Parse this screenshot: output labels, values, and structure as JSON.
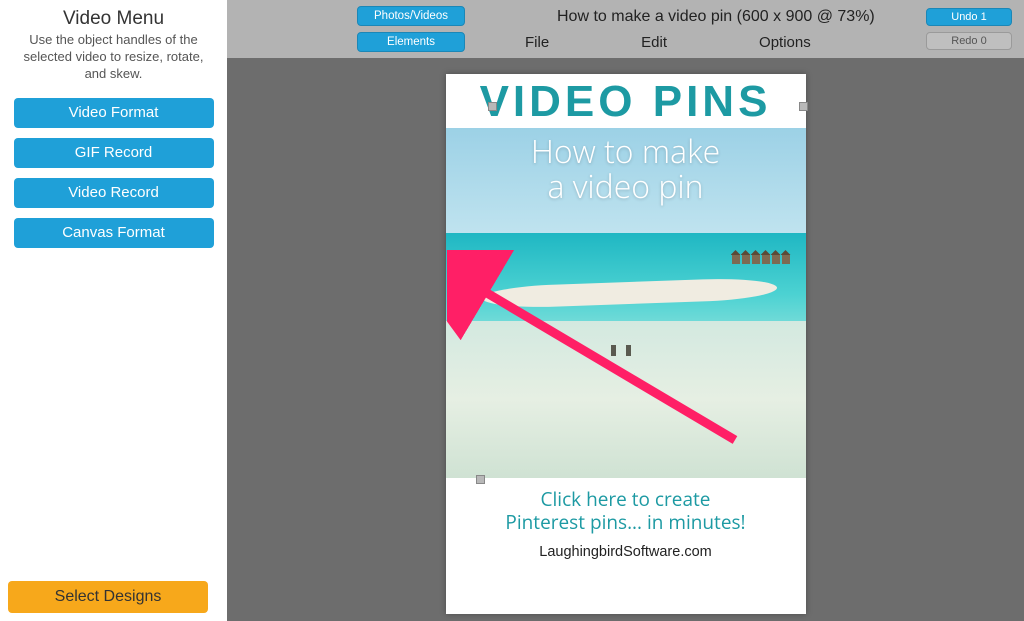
{
  "sidebar": {
    "title": "Video Menu",
    "description": "Use the object handles of the selected video to resize, rotate, and skew.",
    "buttons": [
      {
        "label": "Video Format"
      },
      {
        "label": "GIF Record"
      },
      {
        "label": "Video Record"
      },
      {
        "label": "Canvas Format"
      }
    ],
    "select_designs": "Select Designs"
  },
  "topbar": {
    "photos_videos": "Photos/Videos",
    "elements": "Elements",
    "doc_title": "How to make a video pin (600 x 900 @ 73%)",
    "menu": {
      "file": "File",
      "edit": "Edit",
      "options": "Options"
    },
    "undo": "Undo 1",
    "redo": "Redo 0"
  },
  "pin": {
    "header": "VIDEO PINS",
    "overlay_line1": "How to make",
    "overlay_line2": "a video pin",
    "cta_line1": "Click here to create",
    "cta_line2": "Pinterest pins... in minutes!",
    "footer": "LaughingbirdSoftware.com"
  }
}
